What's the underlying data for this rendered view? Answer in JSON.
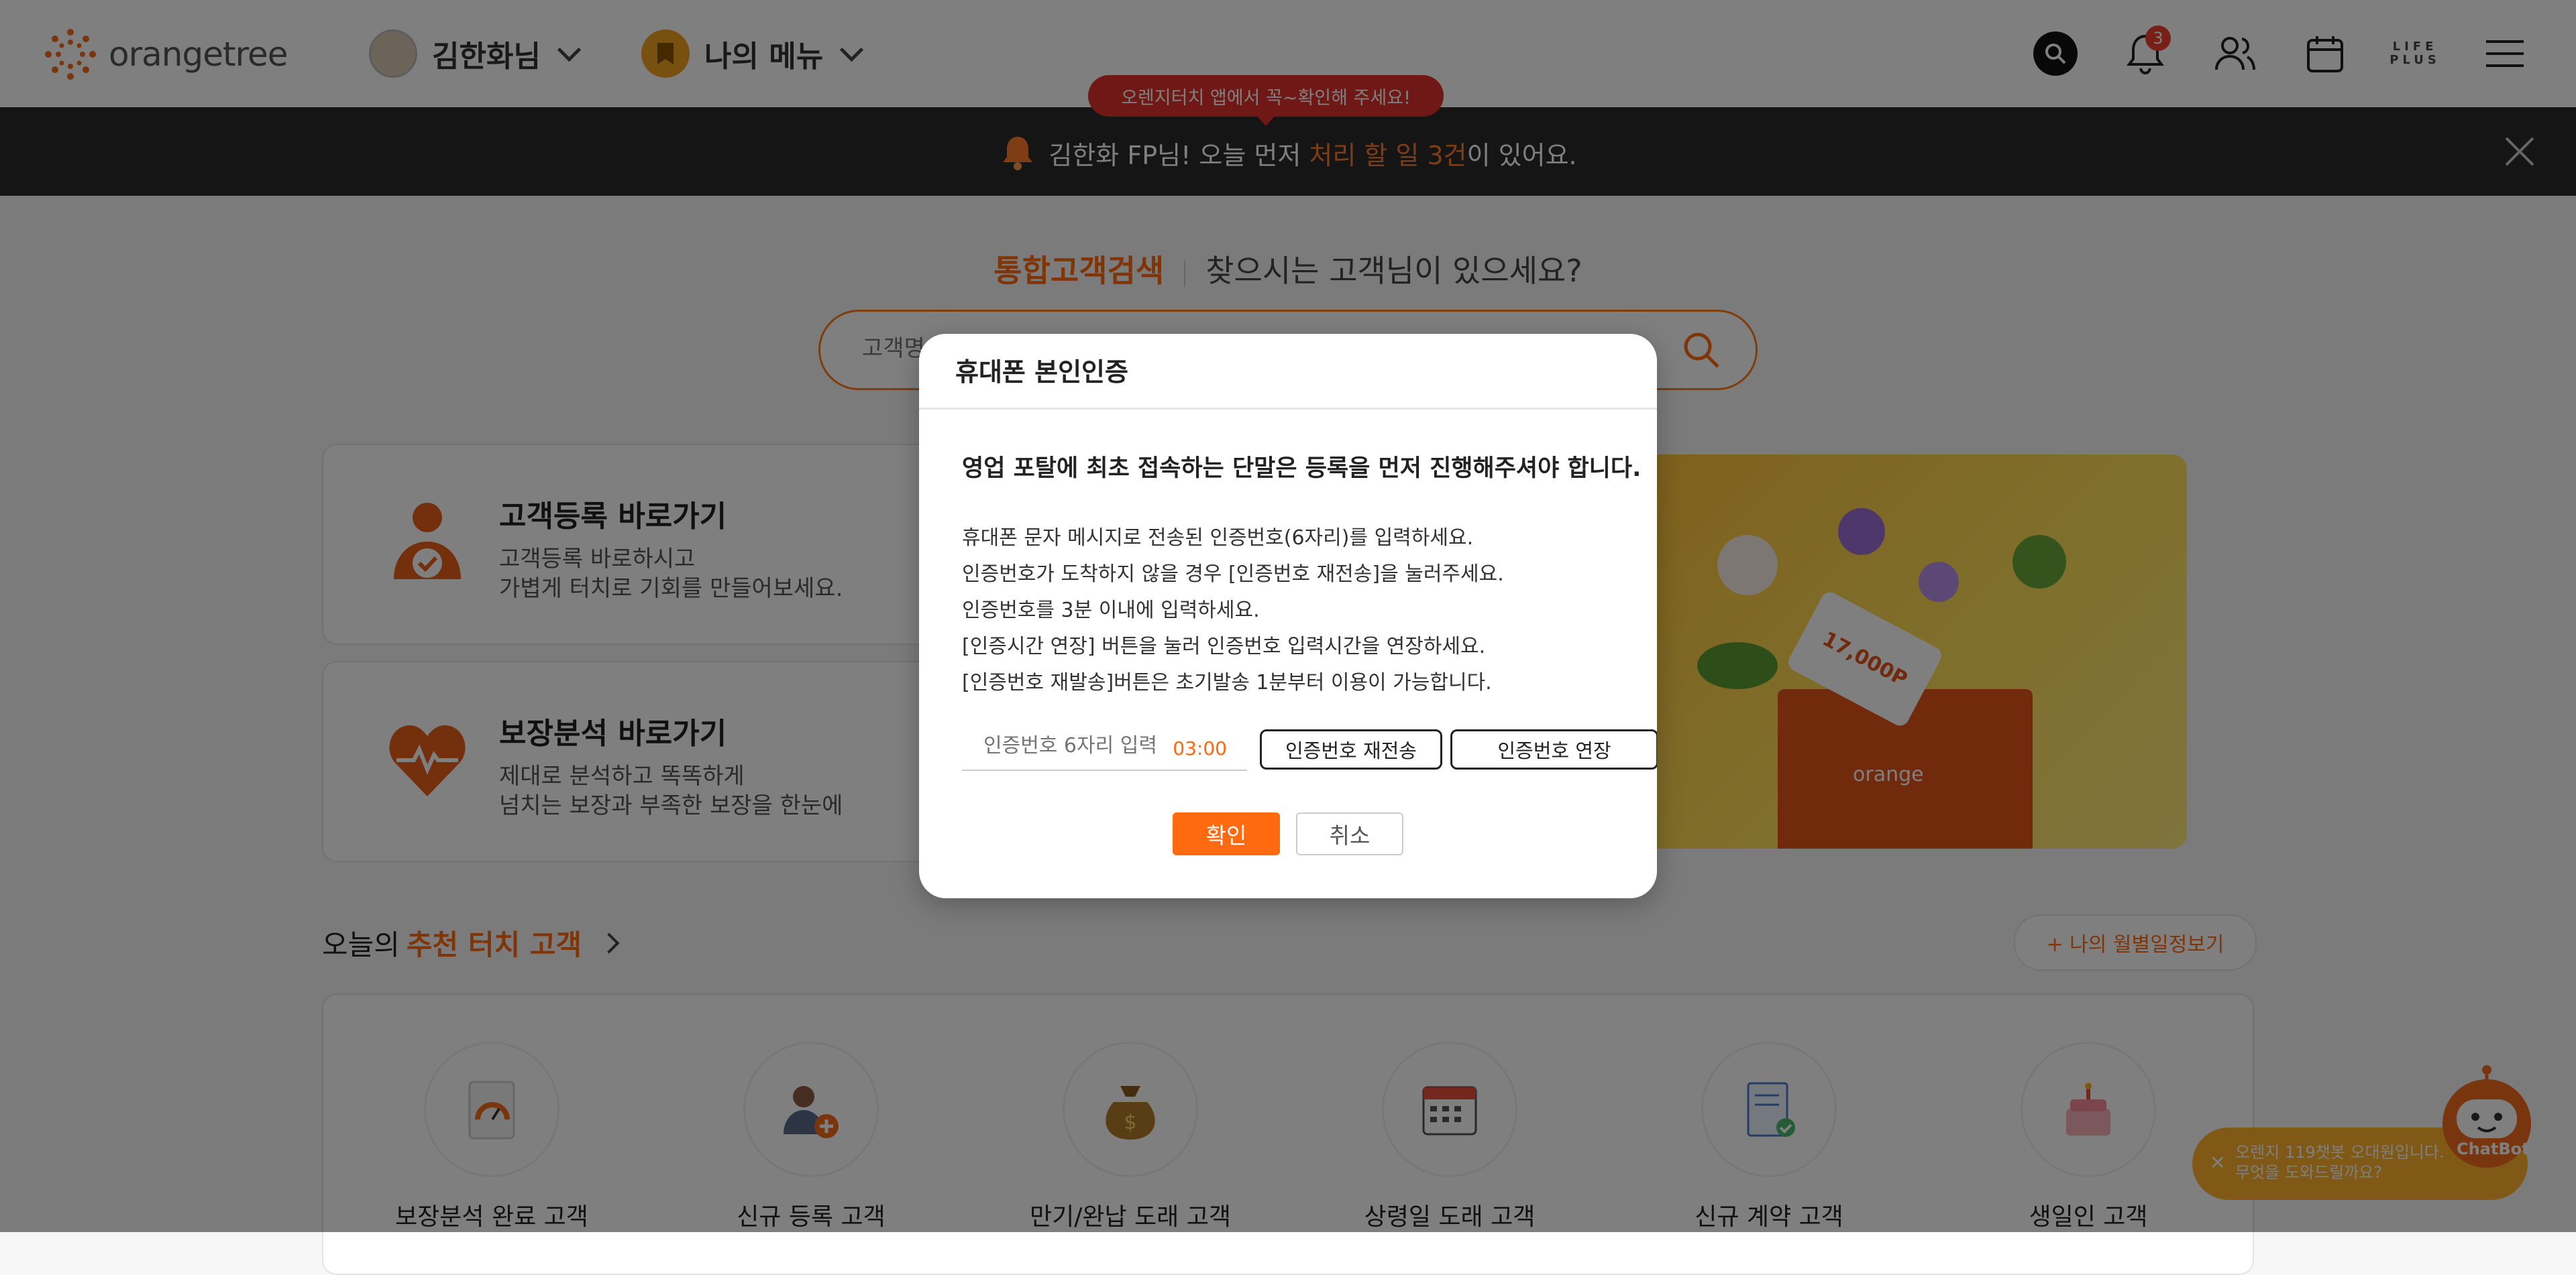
{
  "header": {
    "logo_text": "orangetree",
    "user_name": "김한화님",
    "my_menu_label": "나의 메뉴",
    "notification_count": "3",
    "lifeplus_text": "LIFE PLUS"
  },
  "notice": {
    "app_tip": "오렌지터치 앱에서 꼭~확인해 주세요!",
    "prefix": "김한화 FP님! 오늘 먼저 ",
    "highlight": "처리 할 일 3건",
    "suffix": "이 있어요."
  },
  "search": {
    "title_accent": "통합고객검색",
    "title_text": "찾으시는 고객님이 있으세요?",
    "placeholder": "고객명"
  },
  "cards": [
    {
      "title": "고객등록 바로가기",
      "desc1": "고객등록 바로하시고",
      "desc2": "가볍게 터치로 기회를 만들어보세요."
    },
    {
      "title": "보장분석 바로가기",
      "desc1": "제대로 분석하고 똑똑하게",
      "desc2": "넘치는 보장과 부족한 보장을 한눈에"
    }
  ],
  "banner": {
    "brand": "orange",
    "ticket": "17,000P"
  },
  "recommend": {
    "prefix": "오늘의 ",
    "highlight": "추천 터치 고객",
    "schedule_button": "+ 나의 월별일정보기",
    "items": [
      {
        "label": "보장분석 완료 고객",
        "icon": "gauge-icon"
      },
      {
        "label": "신규 등록 고객",
        "icon": "add-user-icon"
      },
      {
        "label": "만기/완납 도래 고객",
        "icon": "money-bag-icon"
      },
      {
        "label": "상령일 도래 고객",
        "icon": "calendar-icon"
      },
      {
        "label": "신규 계약 고객",
        "icon": "contract-icon"
      },
      {
        "label": "생일인 고객",
        "icon": "cake-icon"
      }
    ]
  },
  "chatbot": {
    "line1": "오렌지 119챗봇 오대원입니다.",
    "line2": "무엇을 도와드릴까요?",
    "label": "ChatBot"
  },
  "modal": {
    "title": "휴대폰 본인인증",
    "heading": "영업 포탈에 최초 접속하는 단말은 등록을 먼저 진행해주셔야 합니다.",
    "lines": [
      "휴대폰 문자 메시지로 전송된 인증번호(6자리)를 입력하세요.",
      "인증번호가 도착하지 않을 경우 [인증번호 재전송]을 눌러주세요.",
      "인증번호를 3분 이내에 입력하세요.",
      "[인증시간 연장] 버튼을 눌러 인증번호 입력시간을 연장하세요.",
      "[인증번호 재발송]버튼은 초기발송 1분부터 이용이 가능합니다."
    ],
    "code_placeholder": "인증번호 6자리 입력",
    "timer": "03:00",
    "resend_button": "인증번호 재전송",
    "extend_button": "인증번호 연장",
    "confirm_button": "확인",
    "cancel_button": "취소"
  },
  "colors": {
    "accent": "#ff6a10",
    "notice_bg": "#2b2b2b",
    "tip_red": "#e0302a",
    "banner_yellow": "#ffc23a"
  }
}
